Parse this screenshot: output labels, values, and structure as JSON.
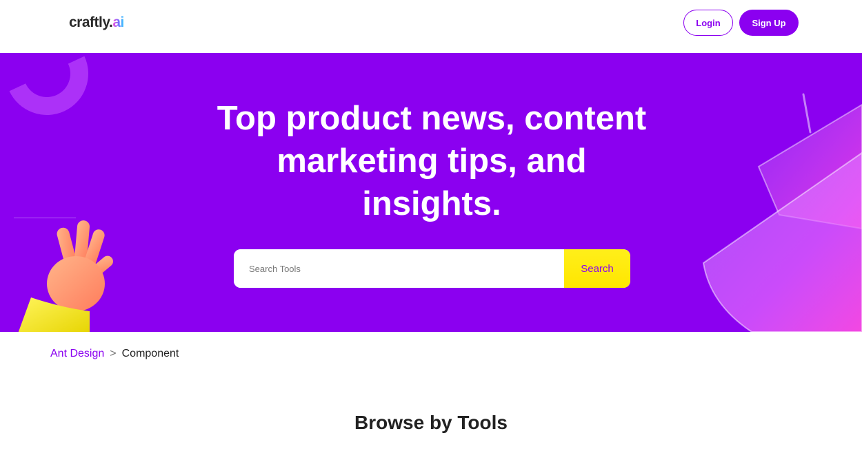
{
  "header": {
    "logo_text": "craftly.",
    "logo_accent": "ai",
    "login_label": "Login",
    "signup_label": "Sign Up"
  },
  "hero": {
    "title": "Top product news, content marketing tips, and insights.",
    "search": {
      "placeholder": "Search Tools",
      "value": "",
      "button_label": "Search"
    }
  },
  "breadcrumb": {
    "items": [
      "Ant Design",
      "Component"
    ],
    "separator": ">"
  },
  "section": {
    "title": "Browse by Tools"
  },
  "colors": {
    "brand": "#8b00f0",
    "search_button": "#ffe600",
    "text_dark": "#222222"
  },
  "icons": [
    "hand-illustration-icon",
    "glass-panel-illustration-icon",
    "ring-decoration-icon"
  ]
}
